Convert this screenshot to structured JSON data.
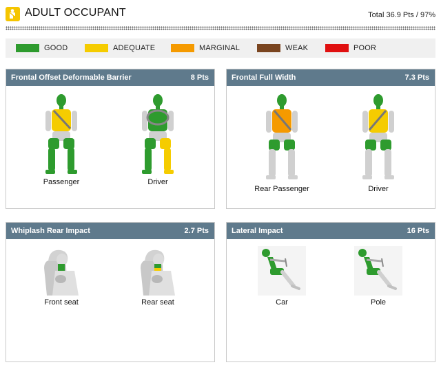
{
  "header": {
    "title": "ADULT OCCUPANT",
    "total": "Total 36.9 Pts / 97%",
    "icon": "seat-occupant-icon"
  },
  "legend": [
    {
      "label": "GOOD",
      "color": "#2e9b2e"
    },
    {
      "label": "ADEQUATE",
      "color": "#f5cc00"
    },
    {
      "label": "MARGINAL",
      "color": "#f59a00"
    },
    {
      "label": "WEAK",
      "color": "#7a4520"
    },
    {
      "label": "POOR",
      "color": "#e01010"
    }
  ],
  "panels": {
    "frontal_offset": {
      "title": "Frontal Offset Deformable Barrier",
      "points": "8 Pts",
      "figures": [
        {
          "label": "Passenger",
          "head": "#2e9b2e",
          "chest": "#f5cc00",
          "legs_left": "#2e9b2e",
          "legs_right": "#2e9b2e"
        },
        {
          "label": "Driver",
          "head": "#2e9b2e",
          "chest": "#2e9b2e",
          "legs_left": "#2e9b2e",
          "legs_right": "#f5cc00"
        }
      ]
    },
    "frontal_full": {
      "title": "Frontal Full Width",
      "points": "7.3 Pts",
      "figures": [
        {
          "label": "Rear Passenger",
          "head": "#2e9b2e",
          "chest": "#f59a00",
          "legs_left": "#2e9b2e",
          "legs_right": "#2e9b2e"
        },
        {
          "label": "Driver",
          "head": "#2e9b2e",
          "chest": "#f5cc00",
          "legs_left": "#2e9b2e",
          "legs_right": "#2e9b2e"
        }
      ]
    },
    "whiplash": {
      "title": "Whiplash Rear Impact",
      "points": "2.7 Pts",
      "figures": [
        {
          "label": "Front seat",
          "neck": "#2e9b2e"
        },
        {
          "label": "Rear seat",
          "neck": "#2e9b2e",
          "neck_lower": "#f5cc00"
        }
      ]
    },
    "lateral": {
      "title": "Lateral Impact",
      "points": "16 Pts",
      "figures": [
        {
          "label": "Car",
          "head": "#2e9b2e",
          "body": "#2e9b2e"
        },
        {
          "label": "Pole",
          "head": "#2e9b2e",
          "body": "#2e9b2e"
        }
      ]
    }
  }
}
